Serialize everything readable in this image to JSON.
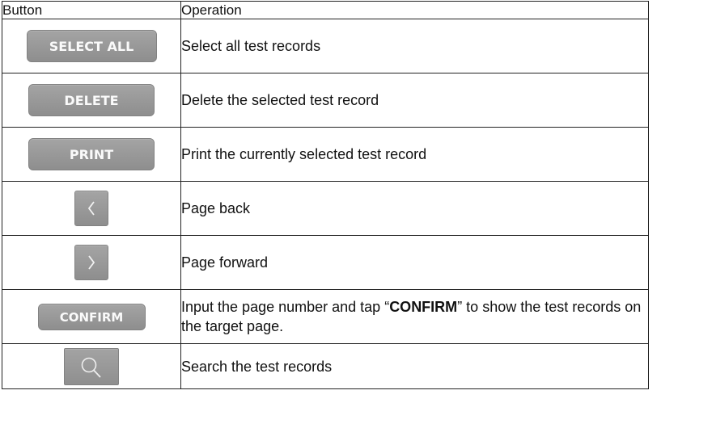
{
  "table": {
    "headers": {
      "button": "Button",
      "operation": "Operation"
    },
    "rows": [
      {
        "button_label": "SELECT ALL",
        "operation": "Select all test records"
      },
      {
        "button_label": "DELETE",
        "operation": "Delete the selected test record"
      },
      {
        "button_label": "PRINT",
        "operation": "Print the currently selected test record"
      },
      {
        "button_icon": "chevron-left-icon",
        "operation": "Page back"
      },
      {
        "button_icon": "chevron-right-icon",
        "operation": "Page forward"
      },
      {
        "button_label": "CONFIRM",
        "operation_prefix": "Input the page number and tap “",
        "operation_keyword": "CONFIRM",
        "operation_suffix": "” to show the test records on the target page."
      },
      {
        "button_icon": "search-icon",
        "operation": "Search the test records"
      }
    ]
  },
  "colors": {
    "button_fill": "#969696",
    "button_text": "#fafafa",
    "table_border": "#222222"
  }
}
